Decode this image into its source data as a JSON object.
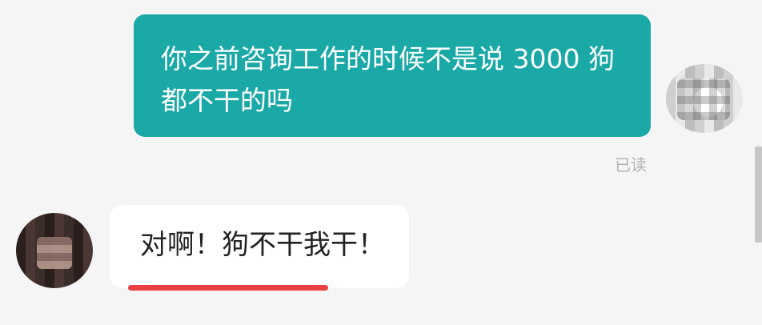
{
  "messages": {
    "outgoing": {
      "line1": "你之前咨询工作的时候不是说 3000 狗",
      "line2": "都不干的吗",
      "status": "已读"
    },
    "incoming": {
      "text": "对啊！狗不干我干！"
    }
  },
  "colors": {
    "outgoing_bubble": "#1aa9a7",
    "incoming_bubble": "#ffffff",
    "background": "#f5f5f5",
    "highlight_underline": "#ea4242"
  },
  "icons": {
    "sender_avatar": "avatar-pixelated",
    "receiver_avatar": "avatar-pixelated"
  }
}
